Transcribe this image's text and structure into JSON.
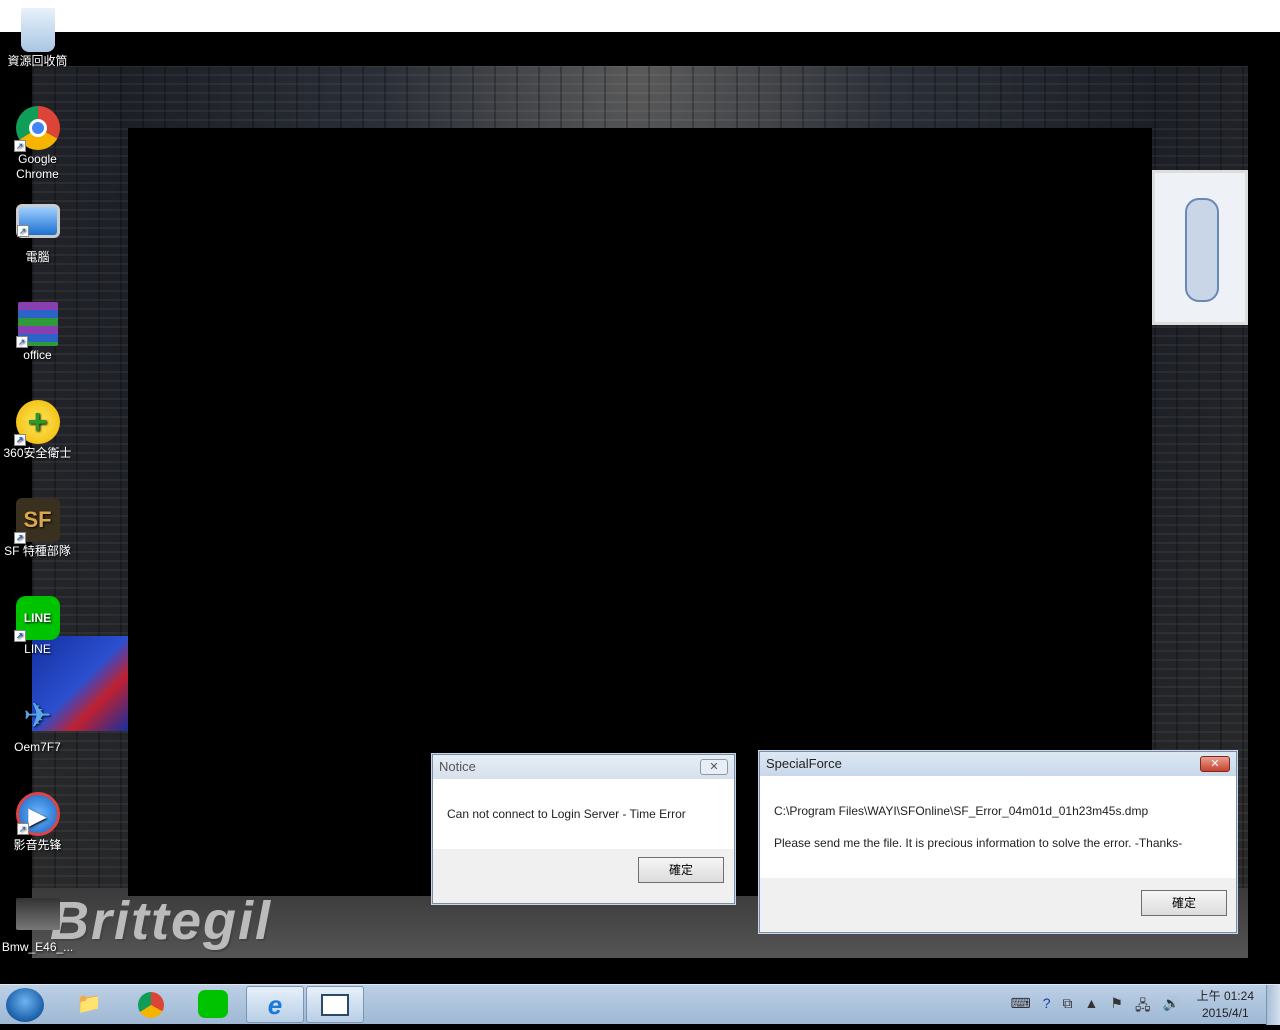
{
  "desktop_icons": [
    {
      "label": "資源回收筒",
      "icon": "recycle-bin-icon"
    },
    {
      "label": "Google Chrome",
      "icon": "chrome-icon"
    },
    {
      "label": "電腦",
      "icon": "computer-icon"
    },
    {
      "label": "office",
      "icon": "winrar-icon"
    },
    {
      "label": "360安全衛士",
      "icon": "360-security-icon"
    },
    {
      "label": "SF 特種部隊",
      "icon": "special-force-icon"
    },
    {
      "label": "LINE",
      "icon": "line-icon"
    },
    {
      "label": "Oem7F7",
      "icon": "oem-icon"
    },
    {
      "label": "影音先锋",
      "icon": "media-player-icon"
    },
    {
      "label": "Bmw_E46_...",
      "icon": "bmw-image-icon"
    }
  ],
  "wallpaper_text": "Brittegil",
  "notice_dialog": {
    "title": "Notice",
    "message": "Can not connect to Login Server - Time Error",
    "ok_label": "確定"
  },
  "sf_dialog": {
    "title": "SpecialForce",
    "path": "C:\\Program Files\\WAYI\\SFOnline\\SF_Error_04m01d_01h23m45s.dmp",
    "message": "Please send me the file. It is precious information to solve the error. -Thanks-",
    "ok_label": "確定"
  },
  "taskbar": {
    "clock_time": "上午 01:24",
    "clock_date": "2015/4/1"
  }
}
